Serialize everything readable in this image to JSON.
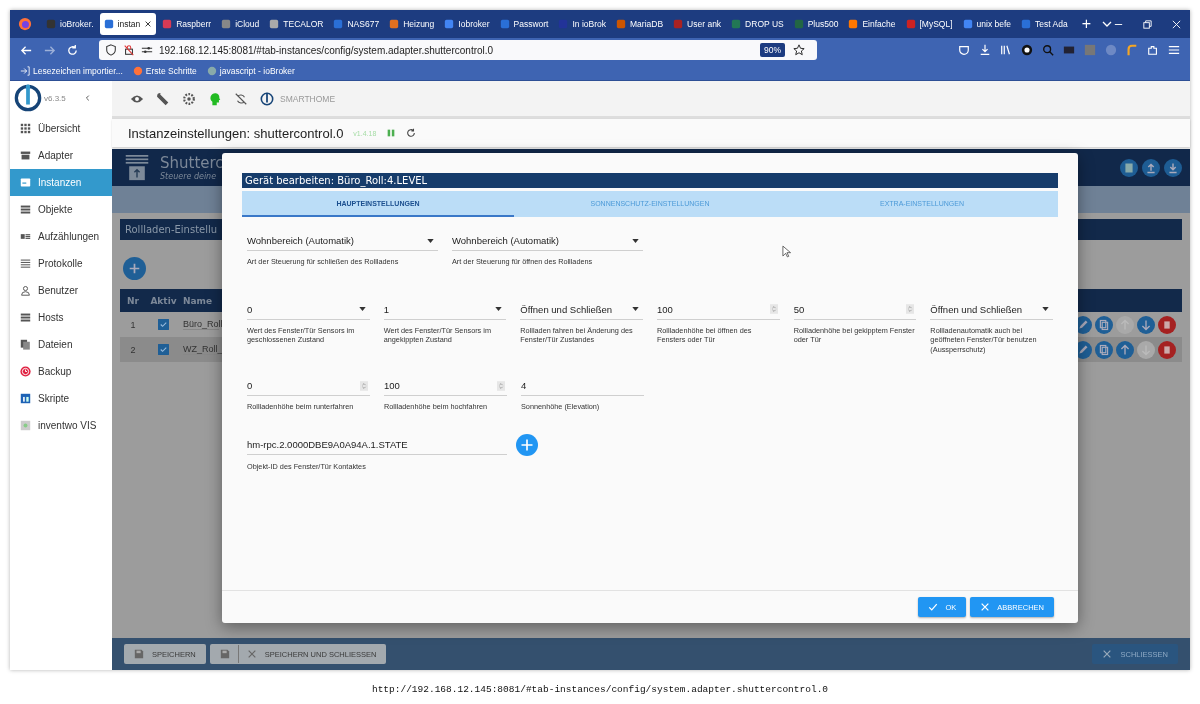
{
  "browser": {
    "tabs": [
      {
        "title": "ioBroker.",
        "selected": false
      },
      {
        "title": "instan",
        "selected": true
      },
      {
        "title": "Raspberr",
        "selected": false
      },
      {
        "title": "iCloud",
        "selected": false
      },
      {
        "title": "TECALOR",
        "selected": false
      },
      {
        "title": "NAS677",
        "selected": false
      },
      {
        "title": "Heizung",
        "selected": false
      },
      {
        "title": "Iobroker",
        "selected": false
      },
      {
        "title": "Passwort",
        "selected": false
      },
      {
        "title": "In ioBrok",
        "selected": false
      },
      {
        "title": "MariaDB",
        "selected": false
      },
      {
        "title": "User ank",
        "selected": false
      },
      {
        "title": "DROP US",
        "selected": false
      },
      {
        "title": "Plus500",
        "selected": false
      },
      {
        "title": "Einfache",
        "selected": false
      },
      {
        "title": "[MySQL]",
        "selected": false
      },
      {
        "title": "unix befe",
        "selected": false
      },
      {
        "title": "Test Ada",
        "selected": false
      }
    ],
    "new_tab": "+",
    "address": "192.168.12.145:8081/#tab-instances/config/system.adapter.shuttercontrol.0",
    "zoom": "90%",
    "bookmarks": [
      "Lesezeichen importier...",
      "Erste Schritte",
      "javascript - ioBroker"
    ]
  },
  "sidebar": {
    "version": "v6.3.5",
    "items": [
      {
        "label": "Übersicht",
        "selected": false
      },
      {
        "label": "Adapter",
        "selected": false
      },
      {
        "label": "Instanzen",
        "selected": true
      },
      {
        "label": "Objekte",
        "selected": false
      },
      {
        "label": "Aufzählungen",
        "selected": false
      },
      {
        "label": "Protokolle",
        "selected": false
      },
      {
        "label": "Benutzer",
        "selected": false
      },
      {
        "label": "Hosts",
        "selected": false
      },
      {
        "label": "Dateien",
        "selected": false
      },
      {
        "label": "Backup",
        "selected": false
      },
      {
        "label": "Skripte",
        "selected": false
      },
      {
        "label": "inventwo VIS",
        "selected": false
      }
    ]
  },
  "toolbar": {
    "brand": "SMARTHOME"
  },
  "instance": {
    "title": "Instanzeinstellungen: shuttercontrol.0",
    "version": "v1.4.18"
  },
  "adapter": {
    "title": "Shutterc",
    "subtitle": "Steuere deine",
    "section": "Rollladen-Einstellu",
    "columns": [
      "Nr",
      "Aktiv",
      "Name"
    ],
    "rows": [
      {
        "nr": "1",
        "active": true,
        "name": "Büro_Roll",
        "can_move_up": false,
        "can_move_down": true
      },
      {
        "nr": "2",
        "active": true,
        "name": "WZ_Roll_",
        "can_move_up": true,
        "can_move_down": false
      }
    ]
  },
  "dialog": {
    "title": "Gerät bearbeiten: Büro_Roll:4.LEVEL",
    "tabs": [
      {
        "label": "HAUPTEINSTELLUNGEN",
        "selected": true
      },
      {
        "label": "SONNENSCHUTZ-EINSTELLUNGEN",
        "selected": false
      },
      {
        "label": "EXTRA-EINSTELLUNGEN",
        "selected": false
      }
    ],
    "rows": [
      {
        "kind": "wide",
        "fields": [
          {
            "kind": "select",
            "value": "Wohnbereich (Automatik)",
            "label": "Art der Steuerung für schließen des Rollladens"
          },
          {
            "kind": "select",
            "value": "Wohnbereich (Automatik)",
            "label": "Art der Steuerung für öffnen des Rollladens"
          }
        ]
      },
      {
        "kind": "narrow",
        "fields": [
          {
            "kind": "select",
            "value": "0",
            "label": "Wert des Fenster/Tür Sensors im geschlossenen Zustand"
          },
          {
            "kind": "select",
            "value": "1",
            "label": "Wert des Fenster/Tür Sensors im angekippten Zustand"
          },
          {
            "kind": "select",
            "value": "Öffnen und Schließen",
            "label": "Rollladen fahren bei Änderung des Fenster/Tür Zustandes"
          },
          {
            "kind": "number",
            "value": "100",
            "label": "Rollladenhöhe bei öffnen des Fensters oder Tür"
          },
          {
            "kind": "number",
            "value": "50",
            "label": "Rollladenhöhe bei gekipptem Fenster oder Tür"
          },
          {
            "kind": "select",
            "value": "Öffnen und Schließen",
            "label": "Rollladenautomatik auch bei geöffneten Fenster/Tür benutzen (Aussperrschutz)"
          }
        ]
      },
      {
        "kind": "narrow",
        "fields": [
          {
            "kind": "number",
            "value": "0",
            "label": "Rollladenhöhe beim runterfahren"
          },
          {
            "kind": "number",
            "value": "100",
            "label": "Rollladenhöhe beim hochfahren"
          },
          {
            "kind": "text",
            "value": "4",
            "label": "Sonnenhöhe (Elevation)"
          }
        ]
      },
      {
        "kind": "object",
        "fields": [
          {
            "kind": "object-id",
            "value": "hm-rpc.2.0000DBE9A0A94A.1.STATE",
            "label": "Objekt-ID des Fenster/Tür Kontaktes"
          }
        ]
      }
    ],
    "buttons": [
      {
        "label": "OK",
        "kind": "ok"
      },
      {
        "label": "ABBRECHEN",
        "kind": "cancel"
      }
    ]
  },
  "footer": {
    "buttons": [
      {
        "label": "SPEICHERN",
        "kind": "save",
        "disabled": true
      },
      {
        "label": "SPEICHERN UND SCHLIESSEN",
        "kind": "save-close",
        "disabled": true
      },
      {
        "label": "SCHLIESSEN",
        "kind": "close",
        "disabled": false
      }
    ]
  },
  "status_url": "http://192.168.12.145:8081/#tab-instances/config/system.adapter.shuttercontrol.0"
}
